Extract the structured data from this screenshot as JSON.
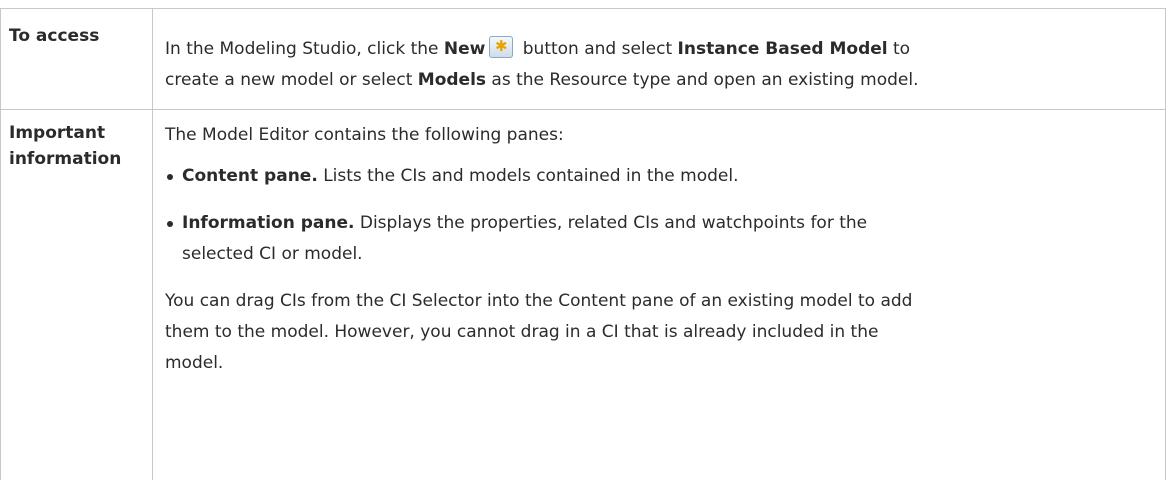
{
  "table": {
    "access": {
      "label": "To access",
      "t1": "In the Modeling Studio, click the ",
      "b1": "New",
      "icon": "new-star-icon",
      "t2": " button and select ",
      "b2": "Instance Based Model",
      "t3": " to",
      "t4": "create a new model or select ",
      "b3": "Models",
      "t5": " as the Resource type and open an existing model."
    },
    "info": {
      "label_line1": "Important",
      "label_line2": "information",
      "intro": "The Model Editor contains the following panes:",
      "bullets": [
        {
          "bold": "Content pane.",
          "text": " Lists the CIs and models contained in the model."
        },
        {
          "bold": "Information pane.",
          "text_line1": " Displays the properties, related CIs and watchpoints for the",
          "text_line2": "selected CI or model."
        }
      ],
      "para_line1": "You can drag CIs from the CI Selector into the Content pane of an existing model to add",
      "para_line2": "them to the model. However, you cannot drag in a CI that is already included in the",
      "para_line3": "model."
    }
  }
}
